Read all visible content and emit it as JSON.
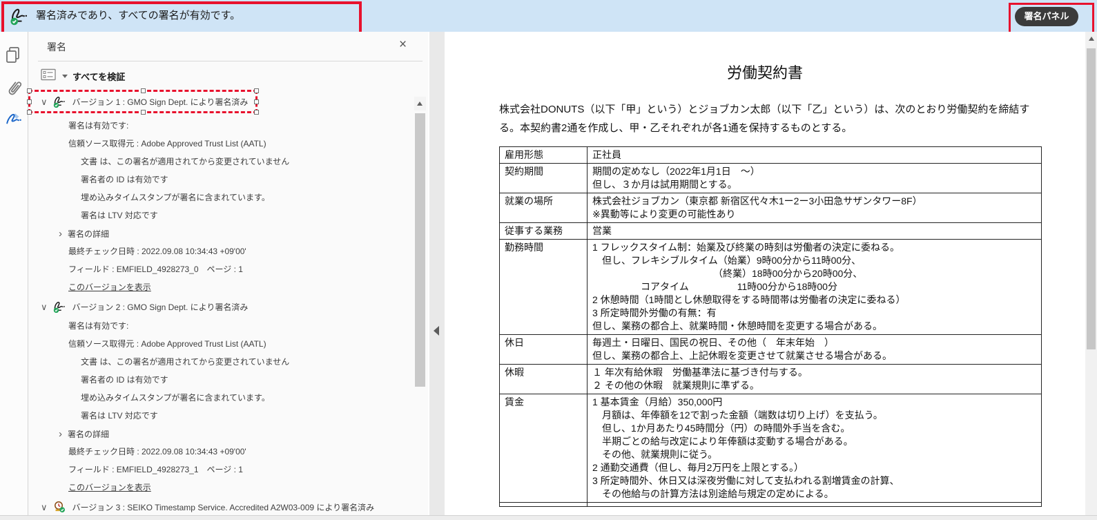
{
  "banner": {
    "message": "署名済みであり、すべての署名が有効です。",
    "panel_button_label": "署名パネル",
    "bg_color": "#cfe4f6",
    "highlight_color": "#e8112d"
  },
  "left_toolbar": {
    "items": [
      {
        "name": "page-thumbnails"
      },
      {
        "name": "attachments"
      },
      {
        "name": "signatures",
        "active": true
      }
    ]
  },
  "panel": {
    "title": "署名",
    "close_glyph": "×",
    "validate_all_label": "すべてを検証",
    "glyphs": {
      "expanded": "∨",
      "collapsed": "›"
    },
    "versions": [
      {
        "label": "バージョン 1 : GMO Sign Dept. により署名済み",
        "icon": "signature",
        "selected": true,
        "status_lines": [
          {
            "text": "署名は有効です:",
            "indent": 0
          },
          {
            "text": "信頼ソース取得元 : Adobe Approved Trust List (AATL)",
            "indent": 0
          },
          {
            "text": "文書 は、この署名が適用されてから変更されていません",
            "indent": 1
          },
          {
            "text": "署名者の ID は有効です",
            "indent": 1
          },
          {
            "text": "埋め込みタイムスタンプが署名に含まれています。",
            "indent": 1
          },
          {
            "text": "署名は LTV 対応です",
            "indent": 1
          }
        ],
        "details_label": "署名の詳細",
        "last_check": "最終チェック日時 : 2022.09.08 10:34:43 +09'00'",
        "field_info": "フィールド : EMFIELD_4928273_0　ページ : 1",
        "view_link": "このバージョンを表示"
      },
      {
        "label": "バージョン 2 : GMO Sign Dept. により署名済み",
        "icon": "signature",
        "selected": false,
        "status_lines": [
          {
            "text": "署名は有効です:",
            "indent": 0
          },
          {
            "text": "信頼ソース取得元 : Adobe Approved Trust List (AATL)",
            "indent": 0
          },
          {
            "text": "文書 は、この署名が適用されてから変更されていません",
            "indent": 1
          },
          {
            "text": "署名者の ID は有効です",
            "indent": 1
          },
          {
            "text": "埋め込みタイムスタンプが署名に含まれています。",
            "indent": 1
          },
          {
            "text": "署名は LTV 対応です",
            "indent": 1
          }
        ],
        "details_label": "署名の詳細",
        "last_check": "最終チェック日時 : 2022.09.08 10:34:43 +09'00'",
        "field_info": "フィールド : EMFIELD_4928273_1　ページ : 1",
        "view_link": "このバージョンを表示"
      },
      {
        "label": "バージョン 3 : SEIKO Timestamp Service. Accredited A2W03-009 により署名済み",
        "icon": "timestamp",
        "selected": false,
        "status_lines": []
      }
    ]
  },
  "document": {
    "title": "労働契約書",
    "intro": "株式会社DONUTS（以下「甲」という）とジョブカン太郎（以下「乙」という）は、次のとおり労働契約を締結する。本契約書2通を作成し、甲・乙それぞれが各1通を保持するものとする。",
    "table": {
      "rows": [
        {
          "label": "雇用形態",
          "lines": [
            "正社員"
          ]
        },
        {
          "label": "契約期間",
          "lines": [
            "期間の定めなし（2022年1月1日　～）",
            "但し、３か月は試用期間とする。"
          ]
        },
        {
          "label": "就業の場所",
          "lines": [
            "株式会社ジョブカン（東京都 新宿区代々木1ー2ー3小田急サザンタワー8F）",
            "※異動等により変更の可能性あり"
          ]
        },
        {
          "label": "従事する業務",
          "lines": [
            "営業"
          ]
        },
        {
          "label": "勤務時間",
          "lines": [
            "1 フレックスタイム制：始業及び終業の時刻は労働者の決定に委ねる。",
            "　但し、フレキシブルタイム（始業）9時00分から11時00分、",
            "　　　　　　　　　　　　　（終業）18時00分から20時00分、",
            "　　　　　コアタイム　　　　　11時00分から18時00分",
            "2 休憩時間（1時間とし休憩取得をする時間帯は労働者の決定に委ねる）",
            "3 所定時間外労働の有無：有",
            "但し、業務の都合上、就業時間・休憩時間を変更する場合がある。"
          ]
        },
        {
          "label": "休日",
          "lines": [
            "毎週土・日曜日、国民の祝日、その他（　年末年始　）",
            "但し、業務の都合上、上記休暇を変更させて就業させる場合がある。"
          ]
        },
        {
          "label": "休暇",
          "lines": [
            "１ 年次有給休暇　労働基準法に基づき付与する。",
            "２ その他の休暇　就業規則に準ずる。"
          ]
        },
        {
          "label": "賃金",
          "lines": [
            "1 基本賃金（月給）350,000円",
            "　月額は、年俸額を12で割った金額（端数は切り上げ）を支払う。",
            "　但し、1か月あたり45時間分（円）の時間外手当を含む。",
            "　半期ごとの給与改定により年俸額は変動する場合がある。",
            "　その他、就業規則に従う。",
            "2 通勤交通費（但し、毎月2万円を上限とする。）",
            "3 所定時間外、休日又は深夜労働に対して支払われる割増賃金の計算、",
            "　その他給与の計算方法は別途給与規定の定めによる。"
          ]
        },
        {
          "label": "",
          "lines": [
            ""
          ],
          "partial": true
        }
      ]
    }
  }
}
